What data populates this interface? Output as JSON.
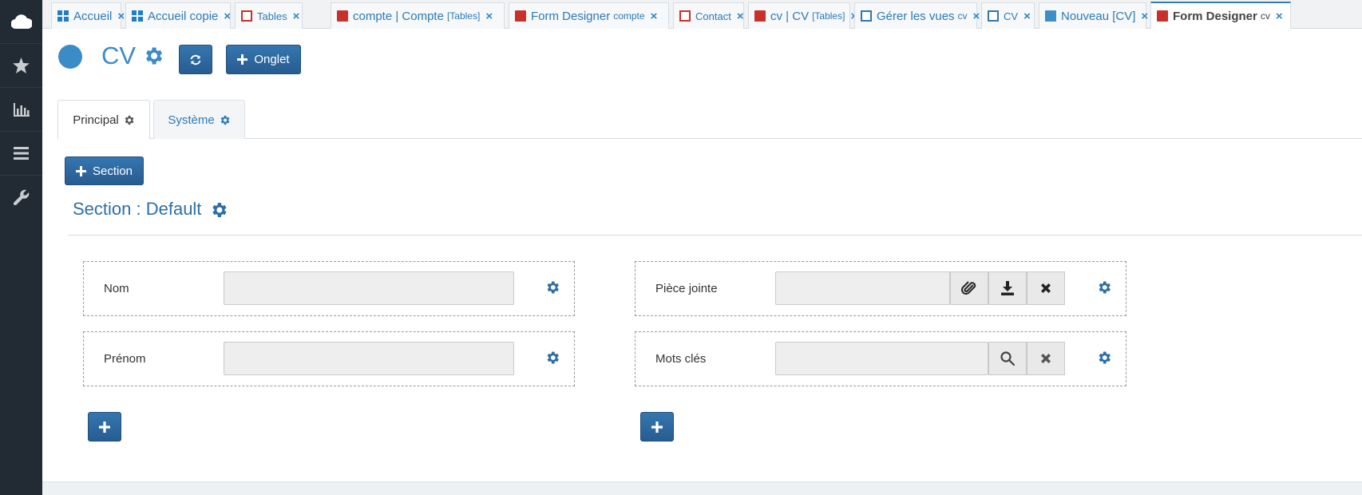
{
  "sidebar": {
    "items": [
      {
        "icon": "cloud-icon"
      },
      {
        "icon": "star-icon"
      },
      {
        "icon": "bar-chart-icon"
      },
      {
        "icon": "list-icon"
      },
      {
        "icon": "wrench-icon"
      }
    ]
  },
  "tabs": [
    {
      "label": "Accueil",
      "small": "",
      "icon": "windows-grid-icon"
    },
    {
      "label": "Accueil copie",
      "small": "",
      "icon": "windows-grid-icon"
    },
    {
      "label": "Tables",
      "small": "",
      "icon": "red-outline-square-icon"
    },
    {
      "label": "compte | Compte",
      "small": "[Tables]",
      "icon": "red-square-icon"
    },
    {
      "label": "Form Designer",
      "small": "compte",
      "icon": "red-square-icon"
    },
    {
      "label": "Contact",
      "small": "",
      "icon": "red-outline-square-icon"
    },
    {
      "label": "cv | CV",
      "small": "[Tables]",
      "icon": "red-square-icon"
    },
    {
      "label": "Gérer les vues",
      "small": "cv",
      "icon": "blue-outline-square-icon"
    },
    {
      "label": "CV",
      "small": "",
      "icon": "blue-outline-square-icon"
    },
    {
      "label": "Nouveau [CV]",
      "small": "",
      "icon": "blue-square-icon"
    },
    {
      "label": "Form Designer",
      "small": "cv",
      "icon": "red-square-icon",
      "active": true
    }
  ],
  "tab_close": "×",
  "header": {
    "title": "CV",
    "onglet_label": "Onglet"
  },
  "form_tabs": [
    {
      "label": "Principal",
      "active": true
    },
    {
      "label": "Système",
      "active": false
    }
  ],
  "section_button_label": "Section",
  "section": {
    "title": "Section : Default"
  },
  "fields": {
    "nom": {
      "label": "Nom",
      "value": ""
    },
    "prenom": {
      "label": "Prénom",
      "value": ""
    },
    "piece_jointe": {
      "label": "Pièce jointe",
      "value": ""
    },
    "mots_cles": {
      "label": "Mots clés",
      "value": ""
    }
  },
  "colors": {
    "accent": "#3b8cc6",
    "button": "#2f6aa3",
    "sidebar": "#222b33",
    "danger": "#c9302c"
  }
}
